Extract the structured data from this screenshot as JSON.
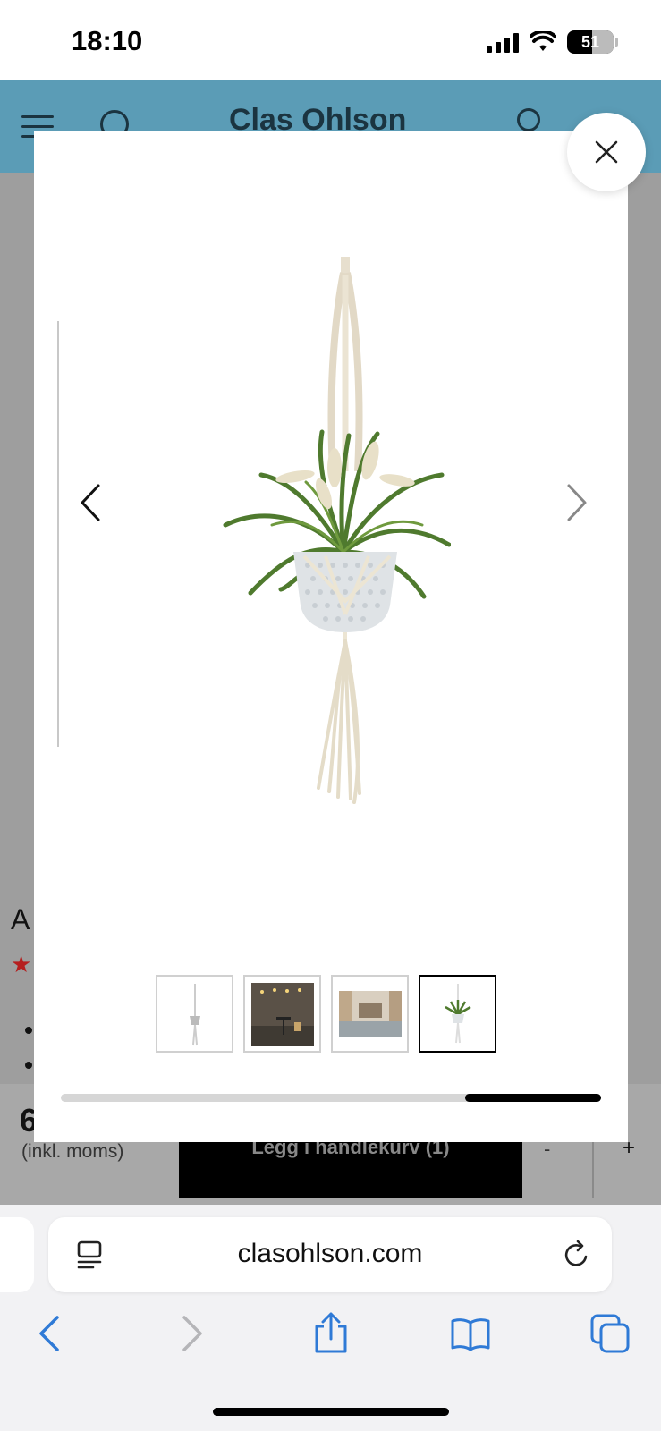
{
  "status_bar": {
    "time": "18:10",
    "battery": "51"
  },
  "site_header": {
    "brand": "Clas Ohlson"
  },
  "page": {
    "title_fragment": "A",
    "rating_star": "★",
    "price_fragment": "6",
    "price_note": "(inkl. moms)",
    "cart_button_label": "Legg i handlekurv (1)",
    "qty_minus": "-",
    "qty_plus": "+"
  },
  "gallery": {
    "active_index": 3,
    "thumbnails": [
      {
        "name": "thumb-1-hanger"
      },
      {
        "name": "thumb-2-patio"
      },
      {
        "name": "thumb-3-room"
      },
      {
        "name": "thumb-4-plant"
      }
    ],
    "scroll_position": 0.75
  },
  "browser": {
    "url": "clasohlson.com"
  },
  "accent_color": "#5b9cb6",
  "toolbar_icon_color": "#2f7ad6"
}
